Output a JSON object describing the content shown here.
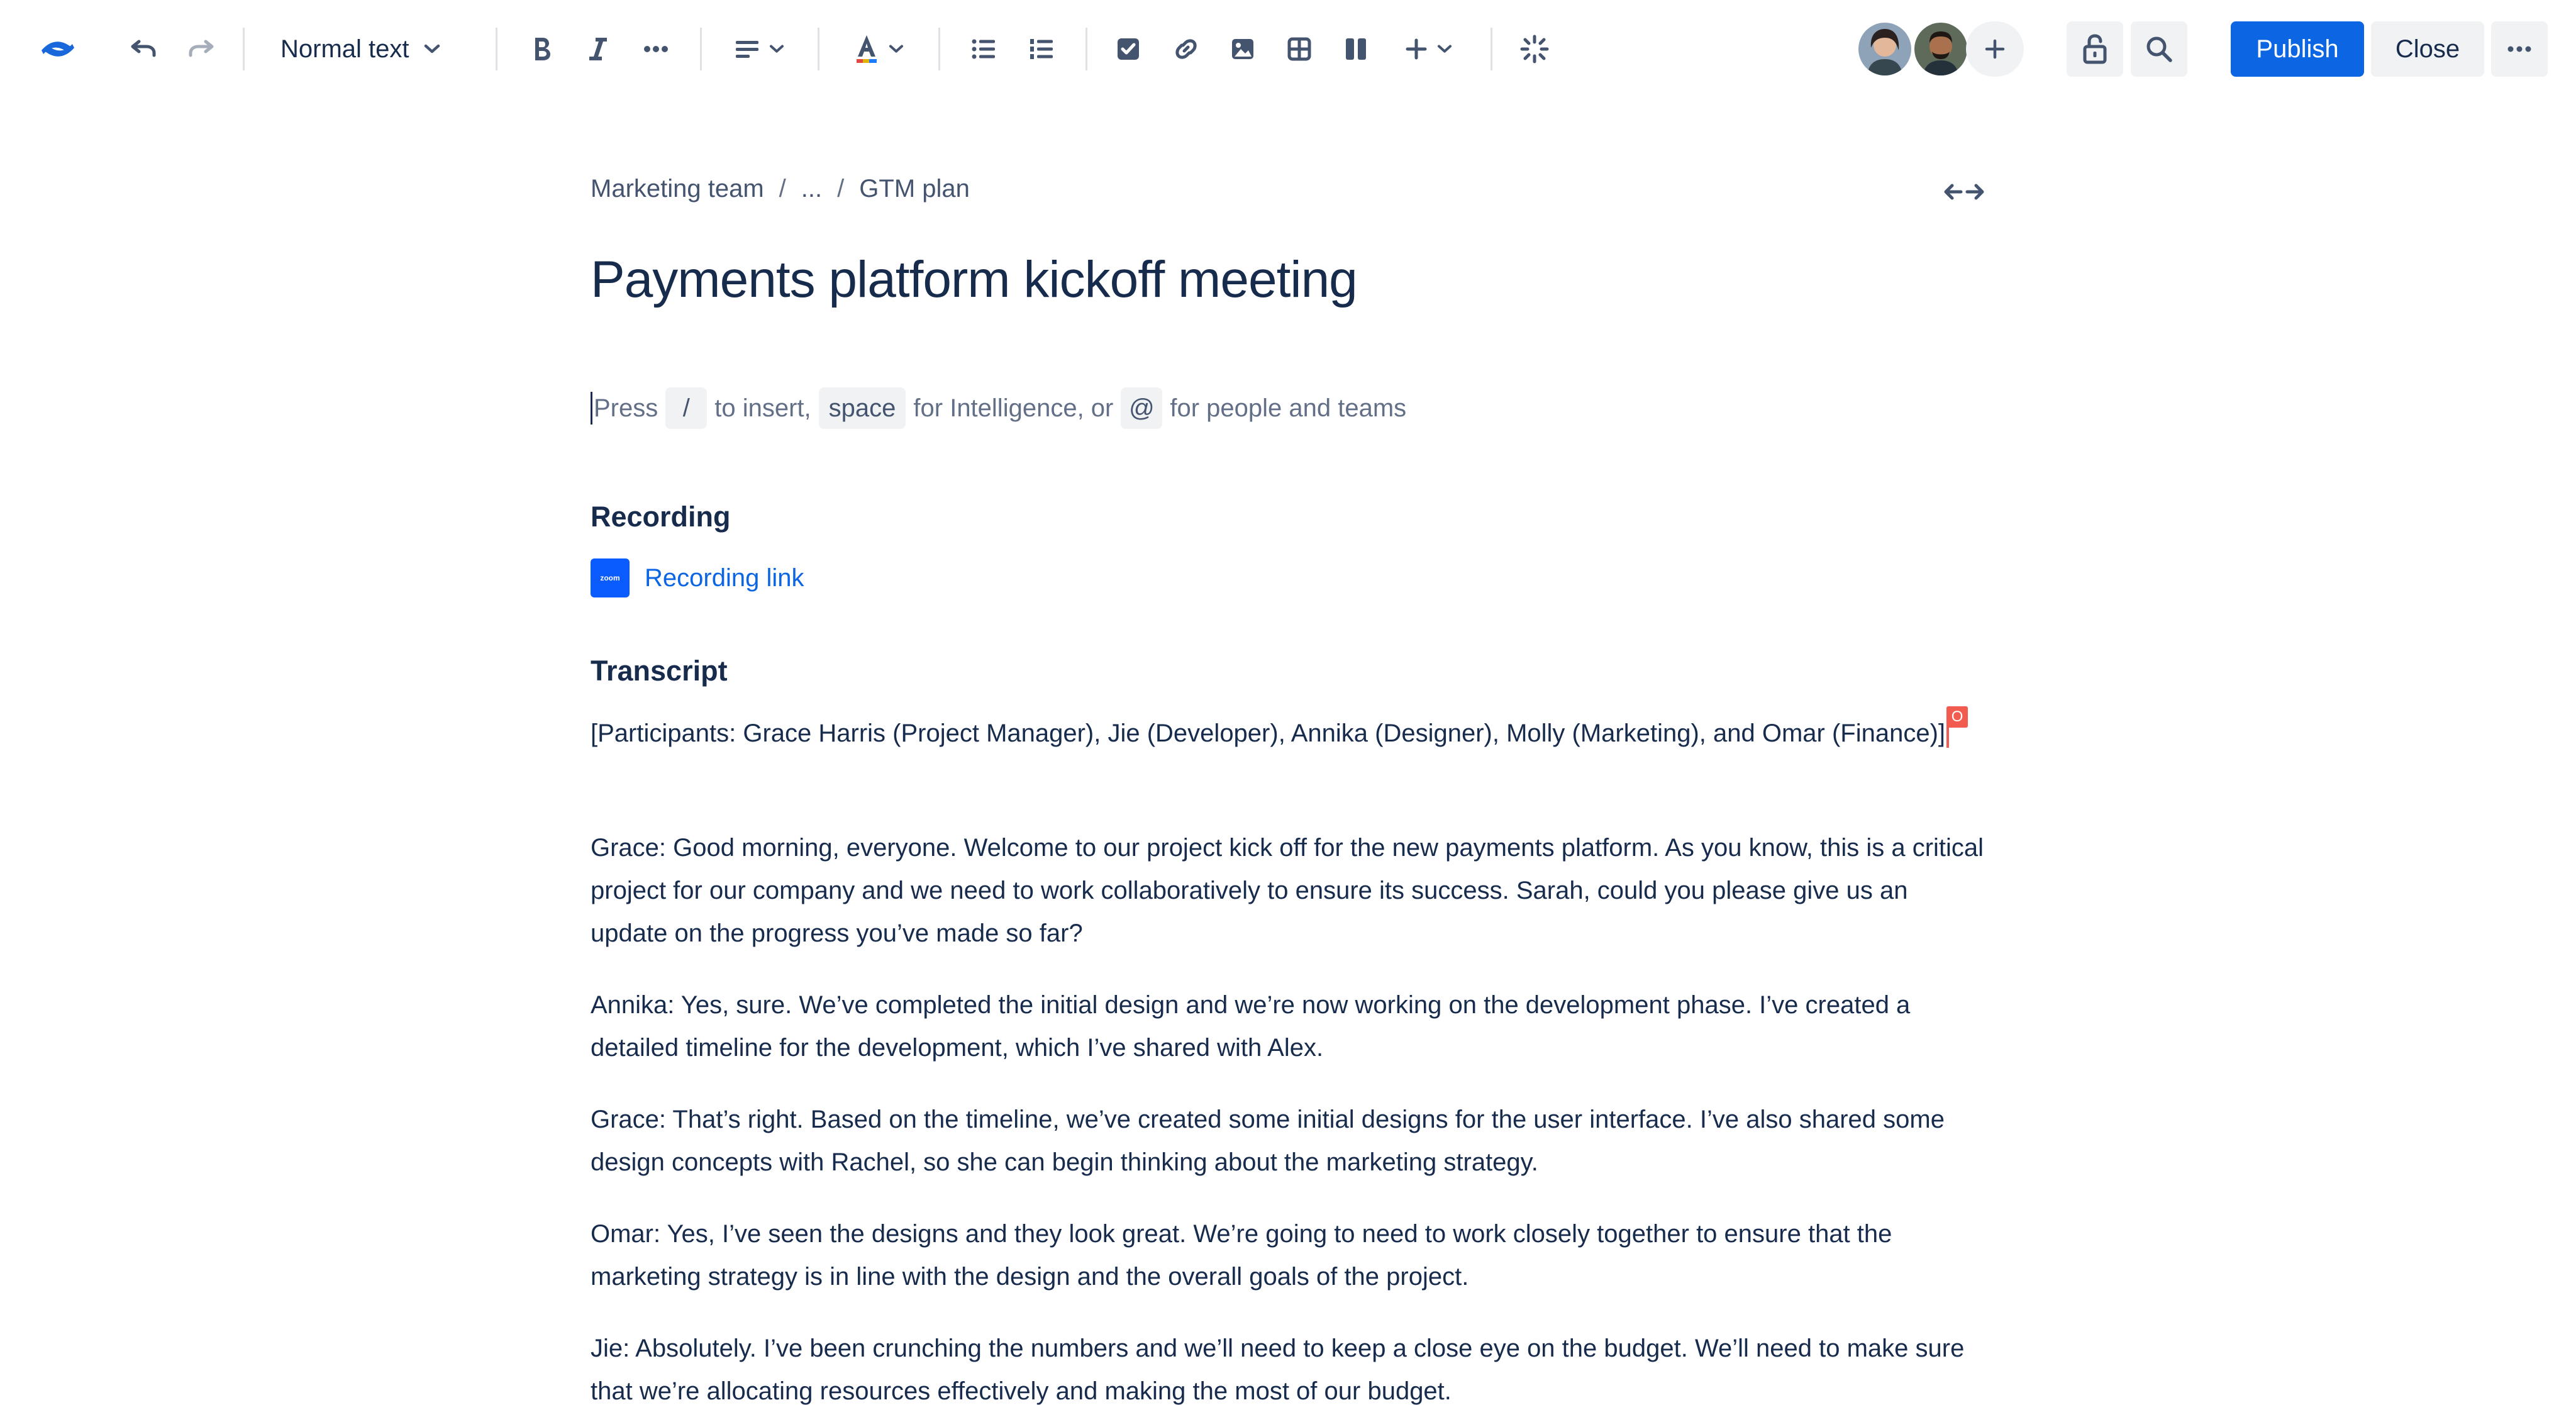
{
  "toolbar": {
    "text_style": "Normal text",
    "publish_label": "Publish",
    "close_label": "Close",
    "accent_color": "#0c66e4",
    "logo_color": "#1868db"
  },
  "breadcrumb": {
    "items": [
      "Marketing team",
      "...",
      "GTM plan"
    ],
    "separator": "/"
  },
  "page": {
    "title": "Payments platform kickoff meeting"
  },
  "editor_hint": {
    "press": "Press",
    "slash_key": "/",
    "to_insert": "to insert,",
    "space_key": "space",
    "for_intelligence": "for Intelligence, or",
    "at_key": "@",
    "for_people": "for people and teams"
  },
  "recording": {
    "heading": "Recording",
    "logo_text": "zoom",
    "link_label": "Recording link"
  },
  "transcript": {
    "heading": "Transcript",
    "cursor_label": "O",
    "cursor_color": "#f15b50",
    "paragraphs": [
      "[Participants: Grace Harris (Project Manager), Jie (Developer),  Annika (Designer), Molly (Marketing), and  Omar (Finance)]",
      "Grace: Good morning, everyone. Welcome to our project kick off for the new payments platform. As you know, this is a critical project for our company and we need to work collaboratively to ensure its success. Sarah, could you please give us an update on the progress you’ve made so far?",
      "Annika: Yes, sure. We’ve completed the initial design and we’re now working on the development phase. I’ve created a detailed timeline for the development, which I’ve shared with Alex.",
      "Grace: That’s right. Based on the timeline, we’ve created some initial designs for the user interface. I’ve also shared some design concepts with Rachel, so she can begin thinking about the marketing strategy.",
      "Omar: Yes, I’ve seen the designs and they look great. We’re going to need to work closely together to ensure that the marketing strategy is in line with the design and the overall goals of the project.",
      "Jie: Absolutely. I’ve been crunching the numbers and we’ll need to keep a close eye on the budget. We’ll need to make sure that we’re allocating resources effectively and making the most of our budget."
    ]
  }
}
